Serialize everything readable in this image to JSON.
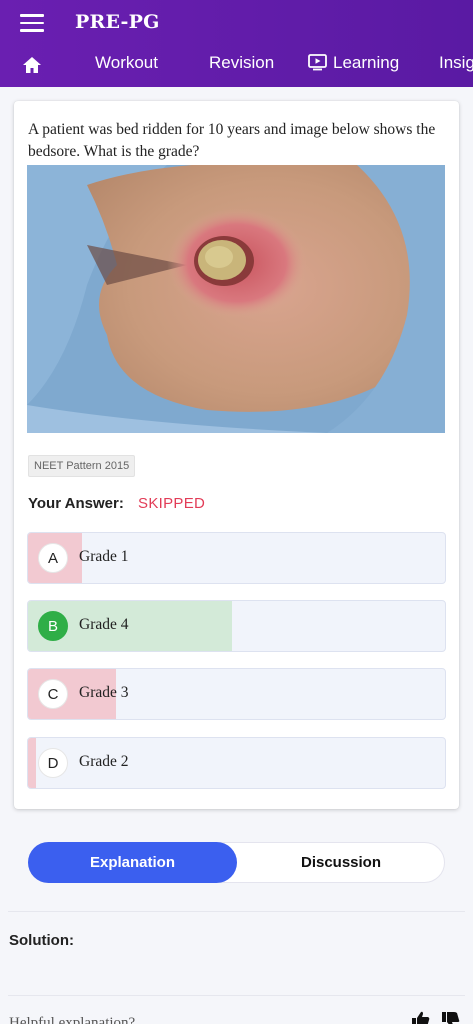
{
  "app": {
    "title": "PRE-PG"
  },
  "tabs": [
    {
      "label": "Workout"
    },
    {
      "label": "Revision"
    },
    {
      "label": "Learning"
    },
    {
      "label": "Insig"
    }
  ],
  "question": {
    "text": "A patient was bed ridden for 10 years and image below shows the bedsore. What is the grade?",
    "tag": "NEET Pattern 2015",
    "your_answer_label": "Your Answer:",
    "your_answer_value": "SKIPPED",
    "options": [
      {
        "letter": "A",
        "text": "Grade 1",
        "percent": 13,
        "correct": false
      },
      {
        "letter": "B",
        "text": "Grade 4",
        "percent": 49,
        "correct": true
      },
      {
        "letter": "C",
        "text": "Grade 3",
        "percent": 21,
        "correct": false
      },
      {
        "letter": "D",
        "text": "Grade 2",
        "percent": 2,
        "correct": false
      }
    ]
  },
  "segments": {
    "active": "Explanation",
    "inactive": "Discussion"
  },
  "solution_label": "Solution:",
  "helpful_label": "Helpful explanation?",
  "colors": {
    "appbar": "#6a1fb1",
    "accent_blue": "#3b5fef",
    "skipped_red": "#e23c57",
    "correct_green": "#2fae47",
    "wrong_fill": "#f2c9d1",
    "correct_fill": "#d3ead8",
    "option_bg": "#f1f4fb"
  },
  "icons": [
    "menu-icon",
    "home-icon",
    "video-icon",
    "thumbs-up-icon",
    "thumbs-down-icon"
  ]
}
